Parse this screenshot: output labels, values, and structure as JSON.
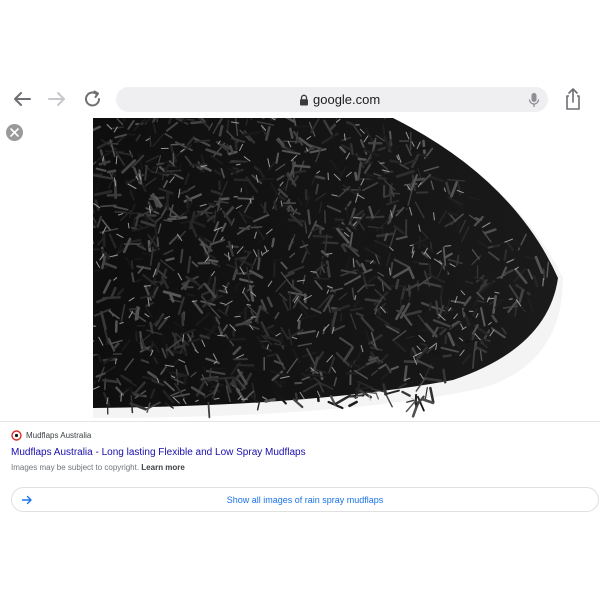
{
  "browser": {
    "url": "google.com",
    "icons": {
      "back": "arrow-left-icon",
      "forward": "arrow-right-icon",
      "reload": "reload-icon",
      "lock": "lock-icon",
      "mic": "microphone-icon",
      "share": "share-icon"
    }
  },
  "viewer": {
    "close_icon": "close-icon",
    "image_alt": "black artificial grass mat"
  },
  "result": {
    "source_name": "Mudflaps Australia",
    "title": "Mudflaps Australia - Long lasting Flexible and Low Spray Mudflaps",
    "copyright_text": "Images may be subject to copyright.",
    "learn_more": "Learn more"
  },
  "show_all": {
    "label": "Show all images of rain spray mudflaps",
    "icon": "arrow-right-icon"
  },
  "colors": {
    "accent": "#1a73e8",
    "title_link": "#1a0dab",
    "address_bar": "#efeff1"
  }
}
